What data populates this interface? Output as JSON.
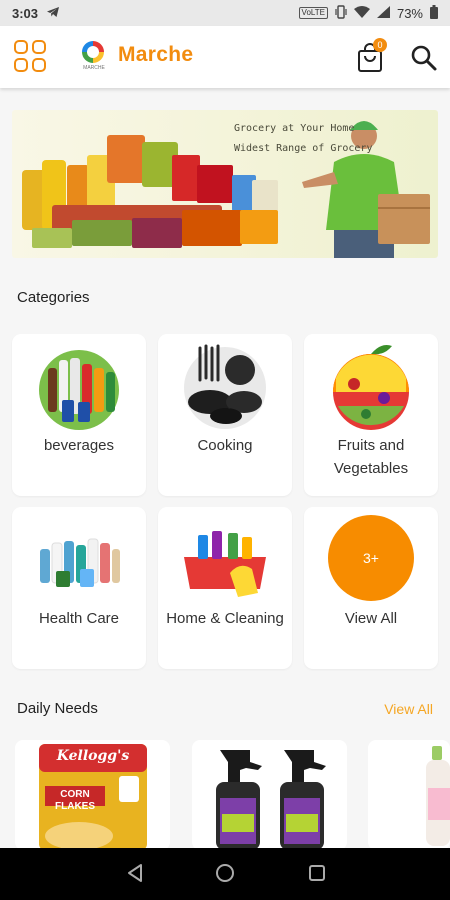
{
  "status_bar": {
    "time": "3:03",
    "network_badge": "VoLTE",
    "battery": "73%"
  },
  "app_bar": {
    "logo_text": "MARCHE",
    "title": "Marche",
    "cart_count": "0"
  },
  "banner": {
    "line1": "Grocery at Your Home",
    "line2": "Widest Range of Grocery"
  },
  "categories": {
    "title": "Categories",
    "items": [
      {
        "label": "beverages",
        "icon": "beverages-icon"
      },
      {
        "label": "Cooking",
        "icon": "cookware-icon"
      },
      {
        "label": "Fruits and Vegetables",
        "icon": "fruits-vegetables-icon"
      },
      {
        "label": "Health Care",
        "icon": "health-care-icon"
      },
      {
        "label": "Home & Cleaning",
        "icon": "cleaning-icon"
      },
      {
        "label": "View All",
        "badge": "3+"
      }
    ]
  },
  "daily_needs": {
    "title": "Daily Needs",
    "view_all": "View All",
    "products": [
      {
        "brand": "Kellogg's",
        "name": "CORN FLAKES",
        "icon": "corn-flakes-icon"
      },
      {
        "brand": "",
        "name": "",
        "icon": "spray-bottles-icon"
      },
      {
        "brand": "",
        "name": "",
        "icon": "bottle-icon"
      }
    ]
  },
  "colors": {
    "accent": "#f28c0f",
    "view_all_circle": "#f78c00",
    "view_all_link": "#f5a623"
  }
}
